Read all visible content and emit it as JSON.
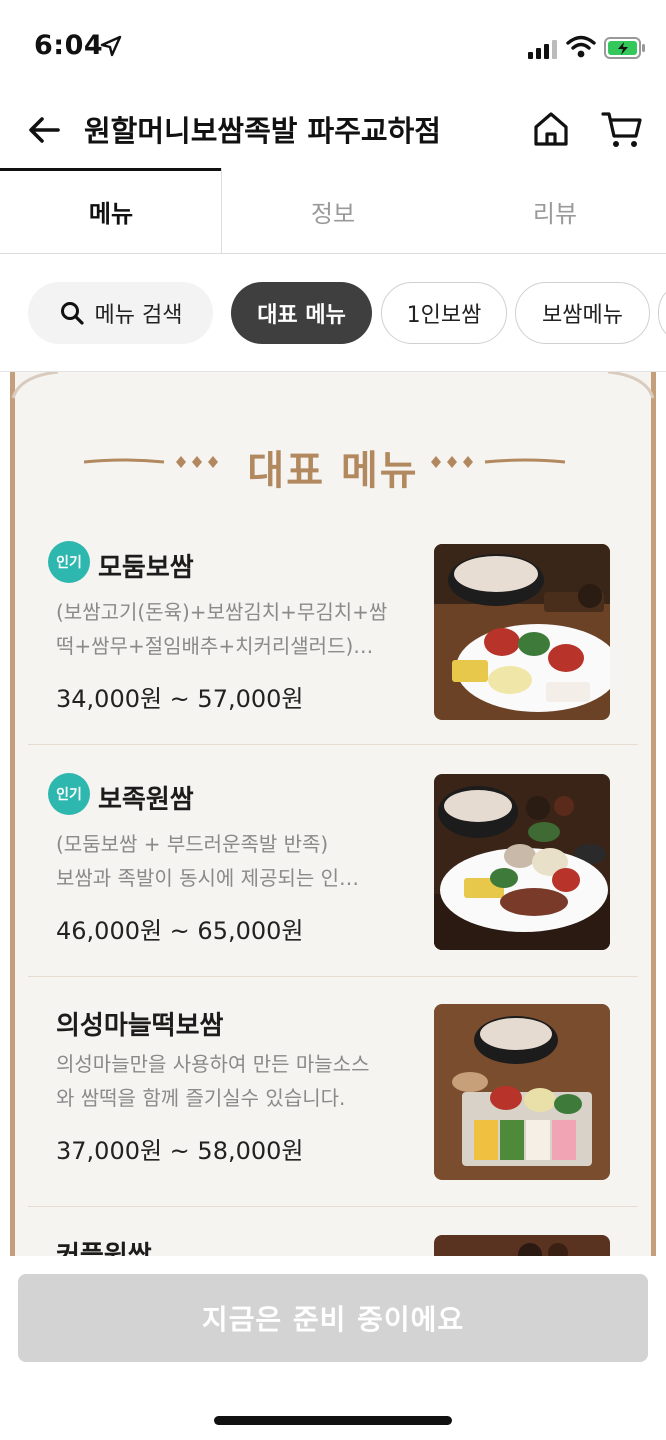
{
  "status_bar": {
    "time": "6:04"
  },
  "header": {
    "title": "원할머니보쌈족발 파주교하점"
  },
  "tabs": [
    {
      "label": "메뉴",
      "active": true
    },
    {
      "label": "정보",
      "active": false
    },
    {
      "label": "리뷰",
      "active": false
    }
  ],
  "chips": {
    "search_label": "메뉴 검색",
    "items": [
      "대표 메뉴",
      "1인보쌈",
      "보쌈메뉴"
    ]
  },
  "section": {
    "title": "대표 메뉴"
  },
  "menu_items": [
    {
      "badge": "인기",
      "name": "모둠보쌈",
      "desc_line1": "(보쌈고기(돈육)+보쌈김치+무김치+쌈",
      "desc_line2": "떡+쌈무+절임배추+치커리샐러드)…",
      "price": "34,000원 ~ 57,000원"
    },
    {
      "badge": "인기",
      "name": "보족원쌈",
      "desc_line1": "(모둠보쌈 + 부드러운족발 반족)",
      "desc_line2": "보쌈과 족발이 동시에 제공되는 인…",
      "price": "46,000원 ~ 65,000원"
    },
    {
      "badge": "",
      "name": "의성마늘떡보쌈",
      "desc_line1": "의성마늘만을 사용하여 만든 마늘소스",
      "desc_line2": "와 쌈떡을 함께 즐기실수 있습니다.",
      "price": "37,000원 ~ 58,000원"
    },
    {
      "badge": "",
      "name": "커플원쌈",
      "desc_line1": "",
      "desc_line2": "",
      "price": ""
    }
  ],
  "cta": {
    "label": "지금은 준비 중이에요"
  },
  "colors": {
    "accent_gold": "#b2885e",
    "popular_badge": "#2eb7ae",
    "chip_active": "#3f3f3f",
    "cta_disabled": "#d3d3d3"
  }
}
